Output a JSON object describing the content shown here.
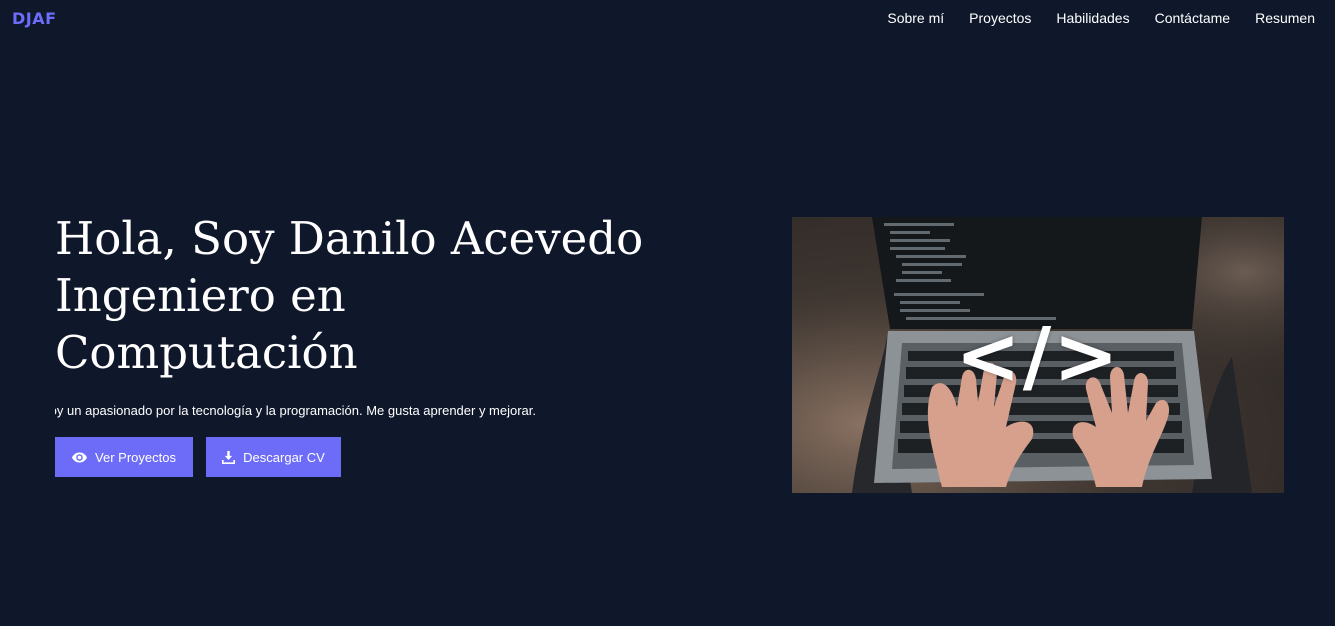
{
  "brand": {
    "logo": "DJAF"
  },
  "nav": {
    "items": [
      "Sobre mí",
      "Proyectos",
      "Habilidades",
      "Contáctame",
      "Resumen"
    ]
  },
  "hero": {
    "title_lines": [
      "Hola, Soy Danilo Acevedo",
      "Ingeniero en",
      "Computación"
    ],
    "subtitle": "Soy un apasionado por la tecnología y la programación. Me gusta aprender y mejorar.",
    "buttons": {
      "projects": {
        "label": "Ver Proyectos",
        "icon": "eye-icon"
      },
      "cv": {
        "label": "Descargar CV",
        "icon": "download-icon"
      }
    },
    "image": {
      "overlay_text": "</>"
    }
  },
  "colors": {
    "background": "#0f172a",
    "accent": "#6c6cf8",
    "logo": "#6d6dfc",
    "text": "#ffffff"
  }
}
